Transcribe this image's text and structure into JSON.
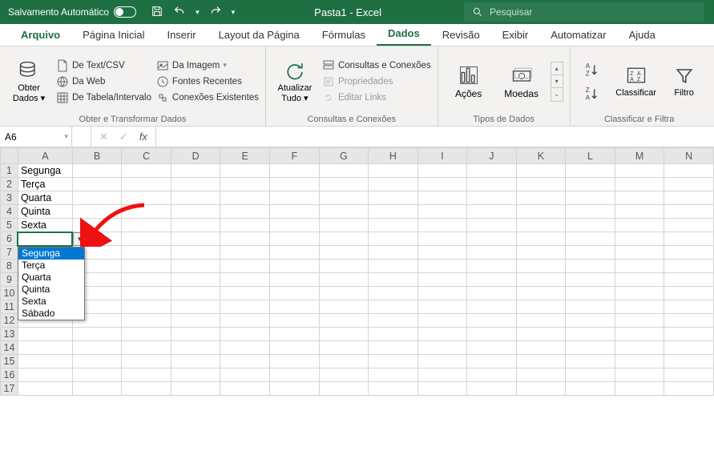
{
  "titlebar": {
    "autosave": "Salvamento Automático",
    "doc_title": "Pasta1  -  Excel",
    "search_placeholder": "Pesquisar"
  },
  "tabs": [
    "Arquivo",
    "Página Inicial",
    "Inserir",
    "Layout da Página",
    "Fórmulas",
    "Dados",
    "Revisão",
    "Exibir",
    "Automatizar",
    "Ajuda"
  ],
  "active_tab": "Dados",
  "ribbon": {
    "group1": {
      "label": "Obter e Transformar Dados",
      "big": "Obter\nDados",
      "items": [
        "De Text/CSV",
        "Da Web",
        "De Tabela/Intervalo",
        "Da Imagem",
        "Fontes Recentes",
        "Conexões Existentes"
      ]
    },
    "group2": {
      "label": "Consultas e Conexões",
      "big": "Atualizar\nTudo",
      "items": [
        "Consultas e Conexões",
        "Propriedades",
        "Editar Links"
      ]
    },
    "group3": {
      "label": "Tipos de Dados",
      "items": [
        "Ações",
        "Moedas"
      ]
    },
    "group4": {
      "label": "Classificar e Filtra",
      "sort": "Classificar",
      "filter": "Filtro"
    }
  },
  "formula": {
    "namebox": "A6"
  },
  "columns": [
    "A",
    "B",
    "C",
    "D",
    "E",
    "F",
    "G",
    "H",
    "I",
    "J",
    "K",
    "L",
    "M",
    "N"
  ],
  "rows": 17,
  "cells": {
    "A1": "Segunga",
    "A2": "Terça",
    "A3": "Quarta",
    "A4": "Quinta",
    "A5": "Sexta"
  },
  "active_cell": "A6",
  "dropdown": {
    "options": [
      "Segunga",
      "Terça",
      "Quarta",
      "Quinta",
      "Sexta",
      "Sábado"
    ],
    "selected": "Segunga"
  }
}
